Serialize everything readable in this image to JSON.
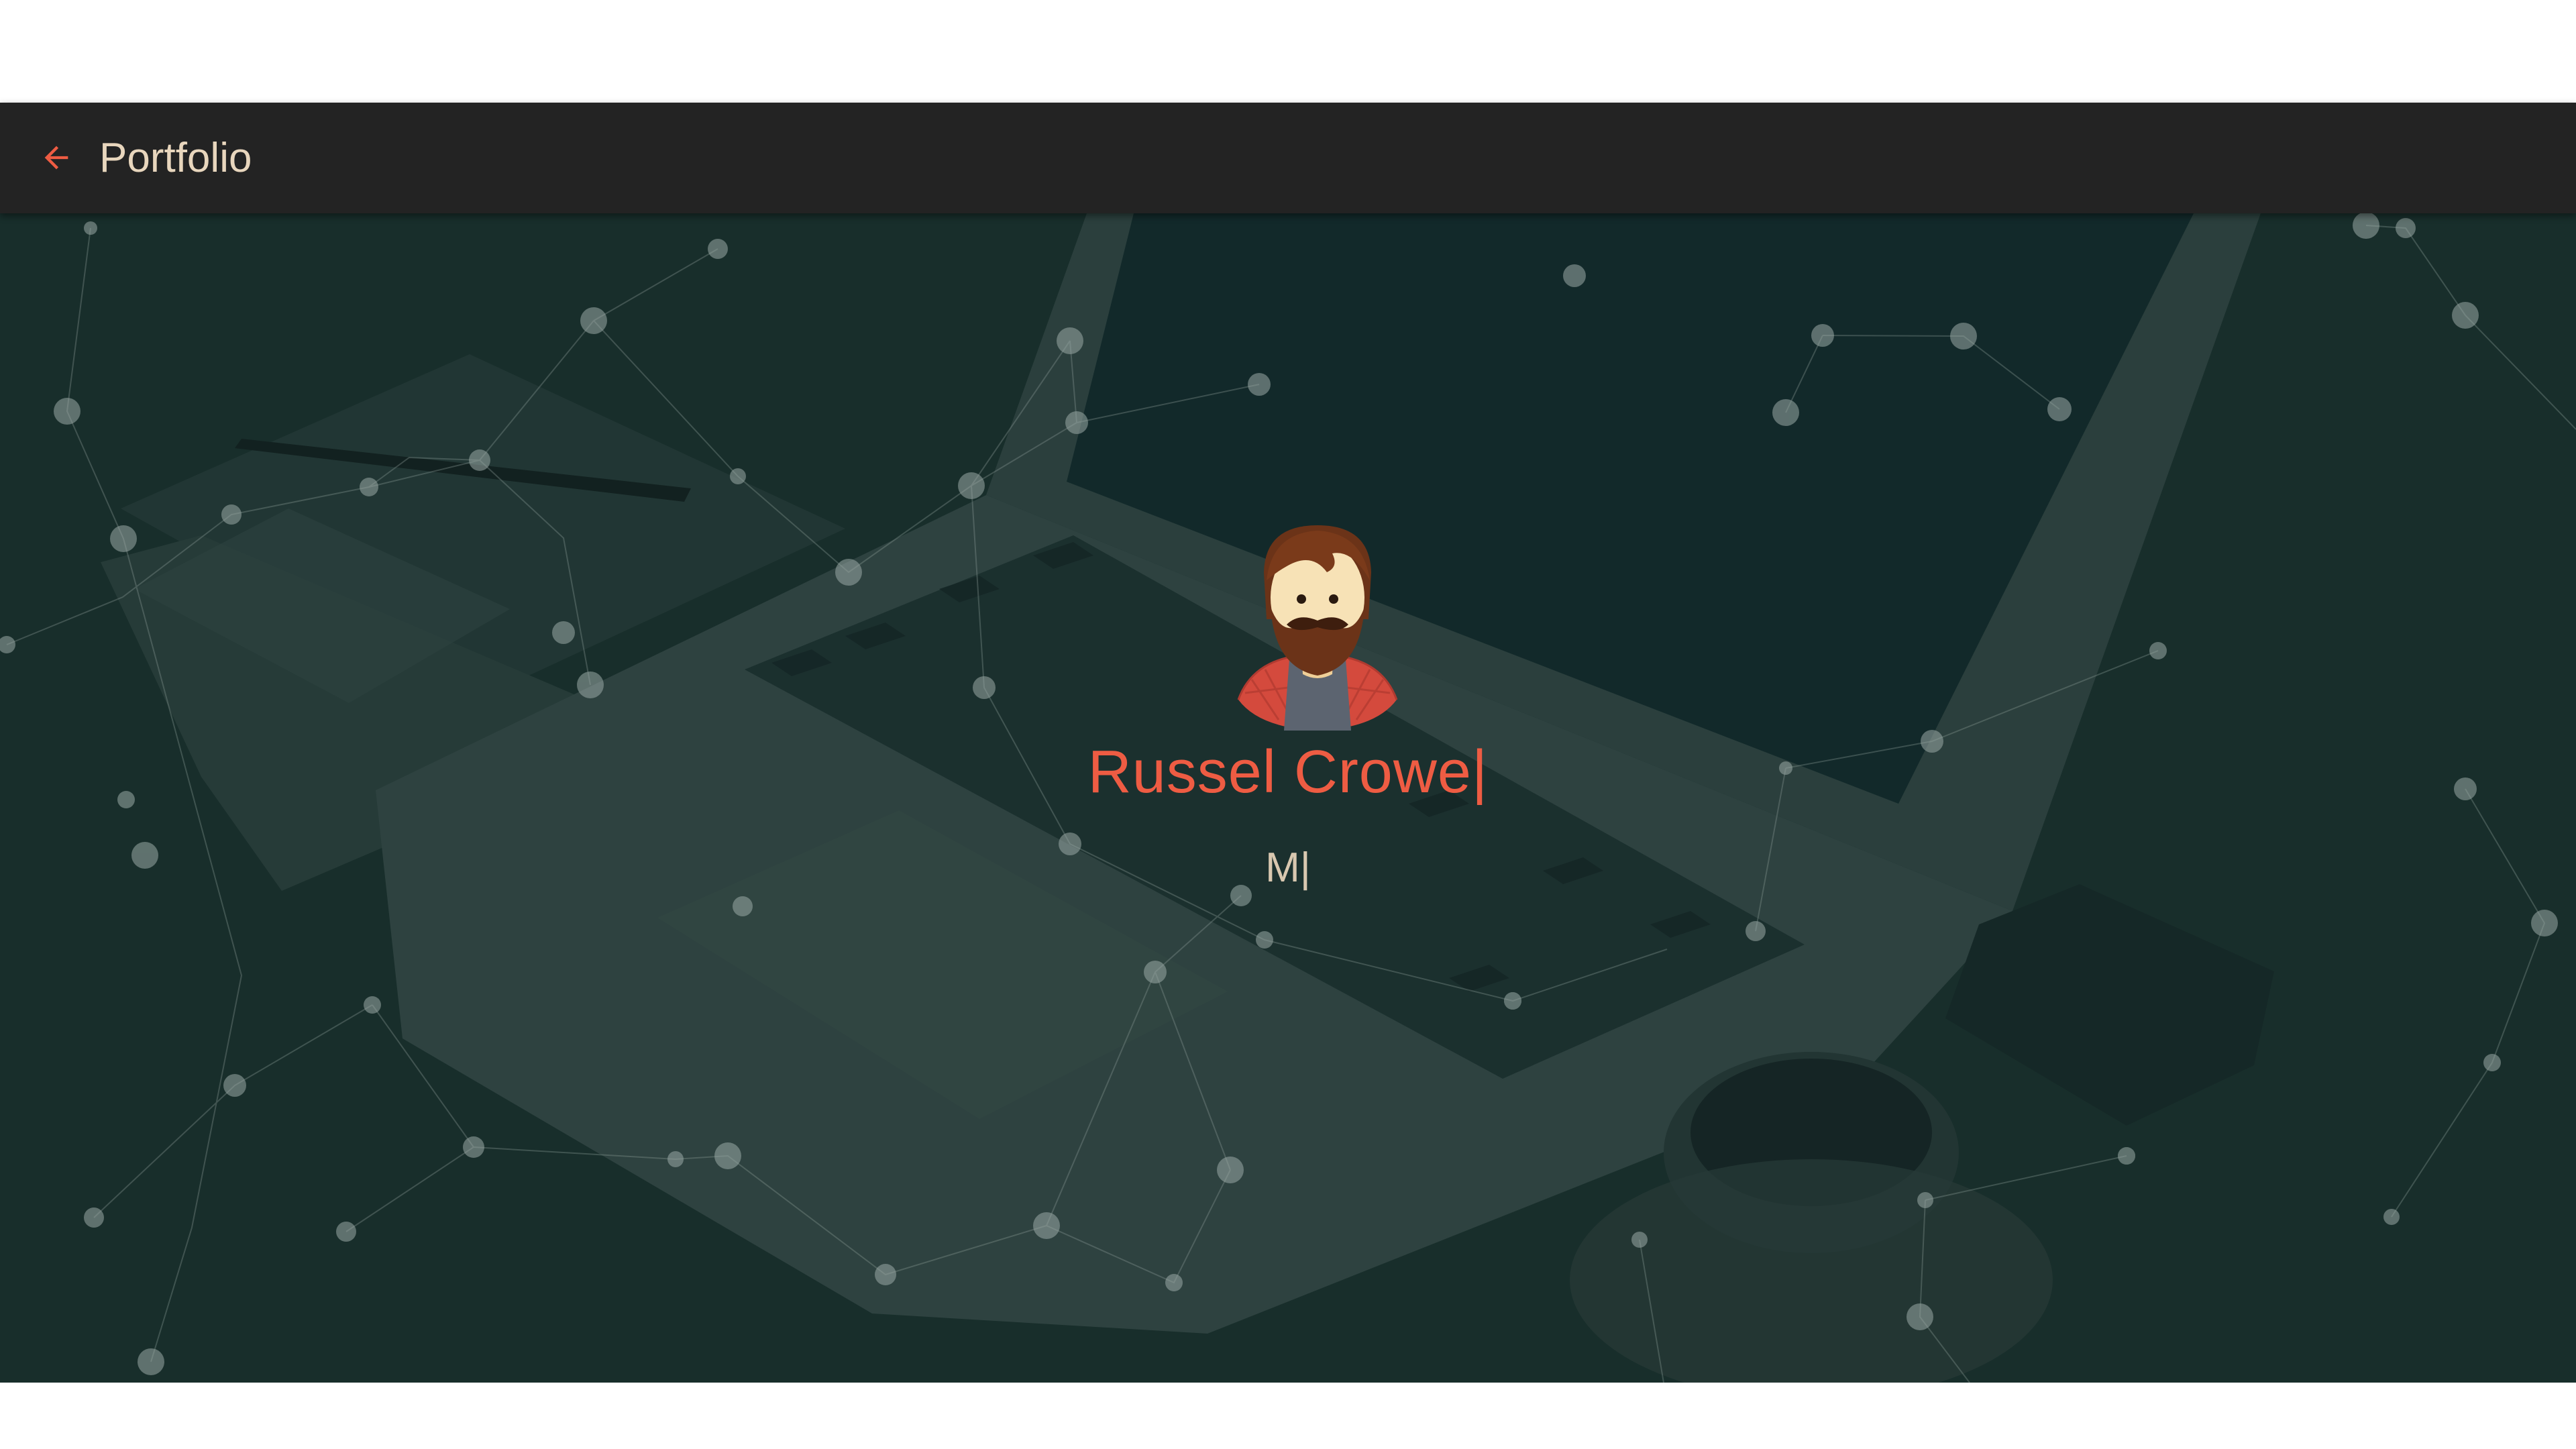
{
  "navbar": {
    "back_icon": "arrow-left-icon",
    "title": "Portfolio",
    "accent_color": "#ee5c43",
    "background_color": "#232323"
  },
  "hero": {
    "name": "Russel Crowe|",
    "typing_text": "M|",
    "avatar_icon": "bearded-man-avatar",
    "name_color": "#ee5c43",
    "background_description_icon": "laptop-desk-photo"
  }
}
